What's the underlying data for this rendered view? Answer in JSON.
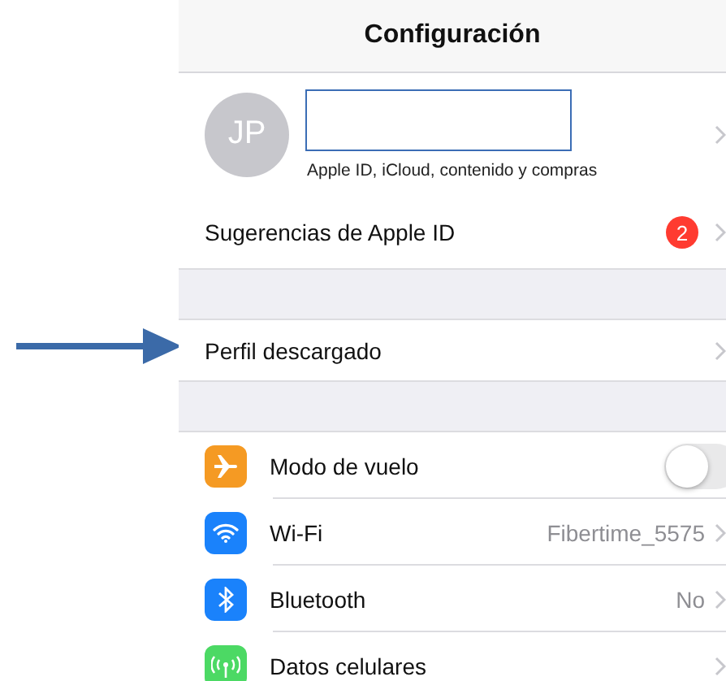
{
  "header": {
    "title": "Configuración"
  },
  "profile": {
    "initials": "JP",
    "subtitle": "Apple ID, iCloud, contenido y compras"
  },
  "suggestions": {
    "label": "Sugerencias de Apple ID",
    "badge": "2"
  },
  "downloaded_profile": {
    "label": "Perfil descargado",
    "highlighted": true
  },
  "settings": [
    {
      "kind": "toggle",
      "color": "#f59a23",
      "label": "Modo de vuelo",
      "on": false
    },
    {
      "kind": "value",
      "color": "#1a82fb",
      "label": "Wi-Fi",
      "value": "Fibertime_5575"
    },
    {
      "kind": "value",
      "color": "#1a82fb",
      "label": "Bluetooth",
      "value": "No"
    },
    {
      "kind": "chevron",
      "color": "#4cd964",
      "label": "Datos celulares"
    }
  ]
}
